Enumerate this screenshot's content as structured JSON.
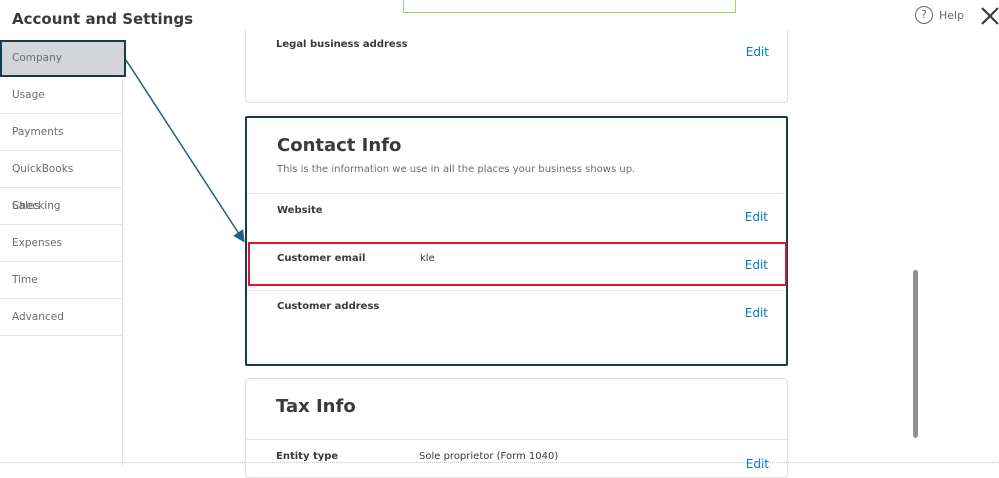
{
  "page": {
    "title": "Account and Settings"
  },
  "header": {
    "help_label": "Help",
    "help_glyph": "?"
  },
  "sidebar": {
    "items": [
      {
        "label": "Company",
        "active": true
      },
      {
        "label": "Usage"
      },
      {
        "label": "Payments"
      },
      {
        "label": "QuickBooks Checking"
      },
      {
        "label": "Sales"
      },
      {
        "label": "Expenses"
      },
      {
        "label": "Time"
      },
      {
        "label": "Advanced"
      }
    ]
  },
  "legal": {
    "label": "Legal business address",
    "edit": "Edit"
  },
  "contact": {
    "title": "Contact Info",
    "description": "This is the information we use in all the places your business shows up.",
    "rows": [
      {
        "label": "Website",
        "value": "",
        "edit": "Edit"
      },
      {
        "label": "Customer email",
        "value": "kle",
        "edit": "Edit"
      },
      {
        "label": "Customer address",
        "value": "",
        "edit": "Edit"
      }
    ]
  },
  "tax": {
    "title": "Tax Info",
    "rows": [
      {
        "label": "Entity type",
        "value": "Sole proprietor (Form 1040)",
        "edit": "Edit"
      }
    ]
  },
  "colors": {
    "accent": "#0077c5",
    "highlight": "#e0182d",
    "outline": "#173a55",
    "field_border": "#a6d26a"
  },
  "icons": {
    "help": "question-circle-icon",
    "close": "close-x-icon"
  }
}
